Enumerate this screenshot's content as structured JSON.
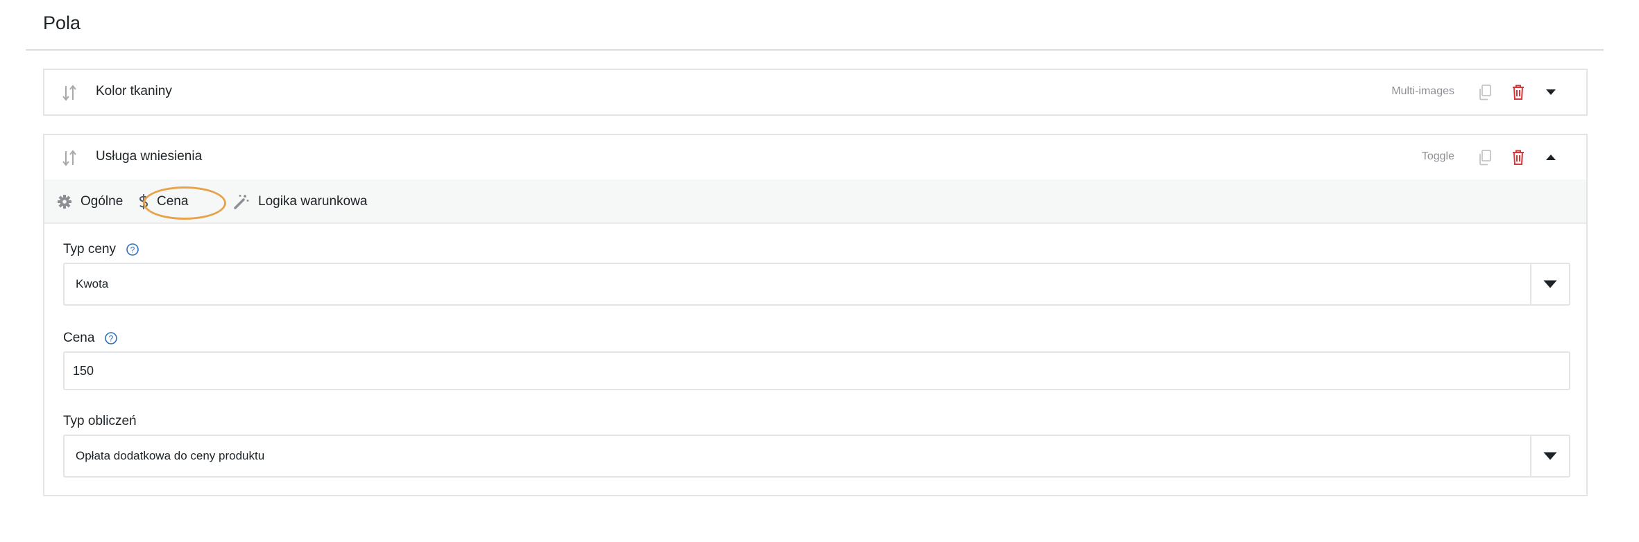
{
  "section": {
    "title": "Pola"
  },
  "fields": [
    {
      "name": "Kolor tkaniny",
      "type": "Multi-images",
      "expanded": false
    },
    {
      "name": "Usługa wniesienia",
      "type": "Toggle",
      "expanded": true,
      "tabs": [
        {
          "label": "Ogólne",
          "icon": "gear-icon"
        },
        {
          "label": "Cena",
          "icon": "dollar-icon",
          "active": true
        },
        {
          "label": "Logika warunkowa",
          "icon": "magic-wand-icon"
        }
      ],
      "form": {
        "price_type": {
          "label": "Typ ceny",
          "value": "Kwota"
        },
        "price": {
          "label": "Cena",
          "value": "150"
        },
        "calculation_type": {
          "label": "Typ obliczeń",
          "value": "Opłata dodatkowa do ceny produktu"
        }
      }
    }
  ],
  "colors": {
    "delete": "#d63638",
    "active_tab": "#2f6fb5",
    "help": "#2f6fb5",
    "highlight": "#e8a24a"
  }
}
